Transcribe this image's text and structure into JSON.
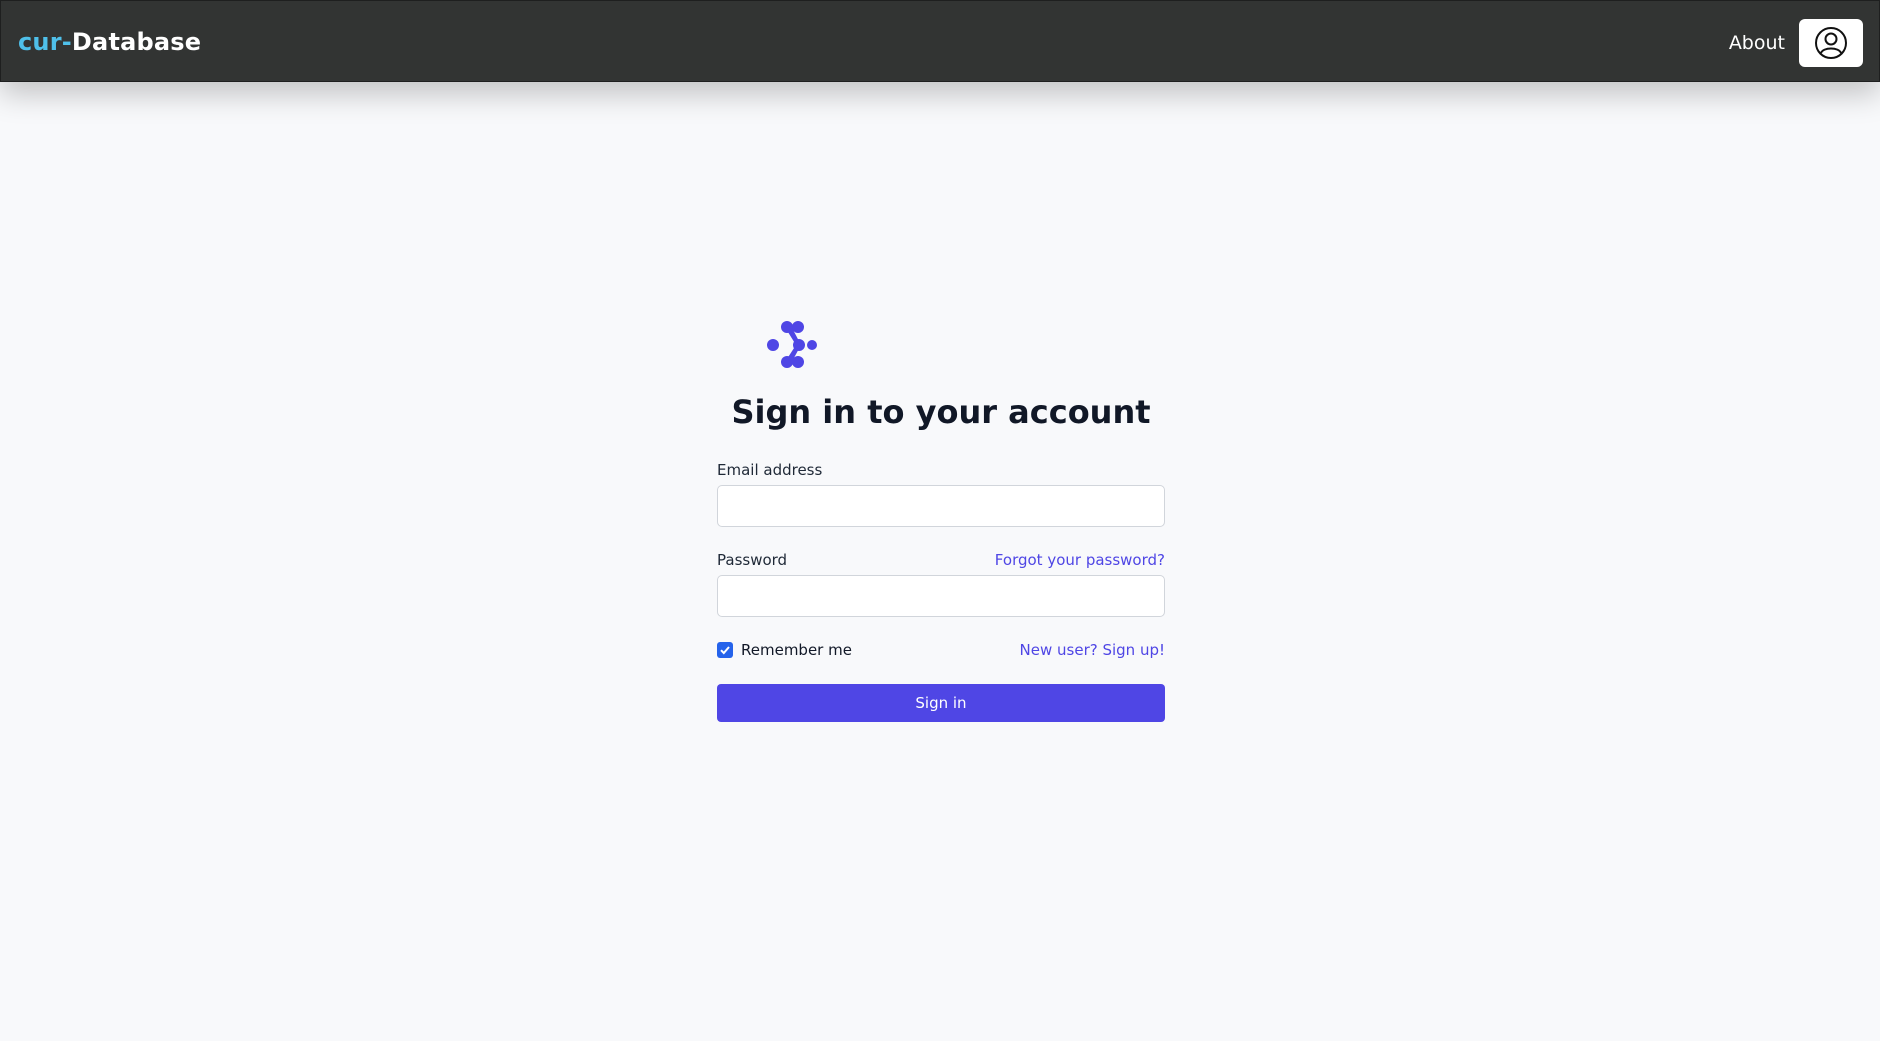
{
  "navbar": {
    "brand_prefix": "cur-",
    "brand_name": "Database",
    "about_label": "About",
    "user_icon": "user-circle-icon"
  },
  "colors": {
    "navbar_bg": "#323433",
    "brand_prefix": "#4fc0ea",
    "accent": "#4f46e5",
    "checkbox": "#2563eb",
    "page_bg": "#f8f9fb"
  },
  "login": {
    "logo_icon": "brand-logo-icon",
    "title": "Sign in to your account",
    "email_label": "Email address",
    "email_value": "",
    "password_label": "Password",
    "password_value": "",
    "forgot_link": "Forgot your password?",
    "remember_label": "Remember me",
    "remember_checked": true,
    "signup_link": "New user? Sign up!",
    "submit_label": "Sign in"
  }
}
